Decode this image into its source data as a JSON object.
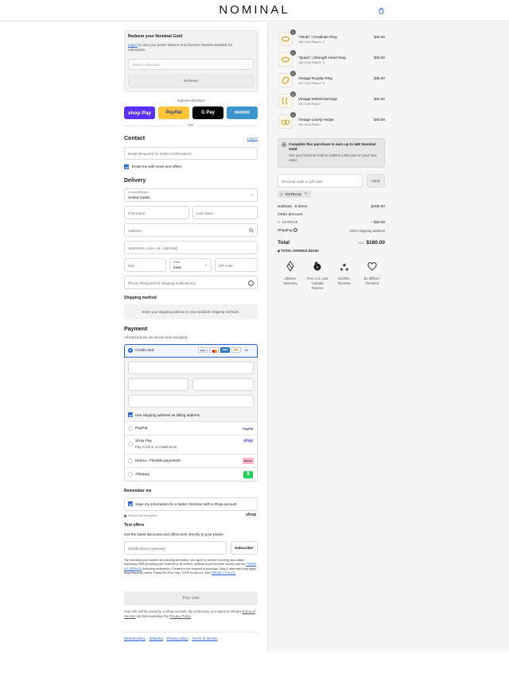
{
  "brand": "NOMINAL",
  "gold": {
    "title": "Redeem your Nominal Gold",
    "login_link": "Log in",
    "desc": "to view your points balance and discover rewards available for redemption.",
    "select_placeholder": "Select a discount",
    "redeem_label": "Redeem"
  },
  "express": {
    "label": "Express checkout",
    "shoppay": "shop Pay",
    "paypal": "PayPal",
    "gpay": "G Pay",
    "venmo": "venmo",
    "or": "OR"
  },
  "contact": {
    "title": "Contact",
    "login_link": "Log in",
    "email_placeholder": "Email (Required for Order Confirmation)",
    "news_label": "Email me with news and offers"
  },
  "delivery": {
    "title": "Delivery",
    "country_label": "Country/Region",
    "country_value": "United States",
    "first_name": "First name",
    "last_name": "Last name",
    "address": "Address",
    "apartment": "Apartment, suite, etc. (optional)",
    "city": "City",
    "state_label": "State",
    "state_value": "Iowa",
    "zip": "ZIP code",
    "phone": "Phone (Required for shipping notifications)"
  },
  "shipping_method": {
    "title": "Shipping method",
    "note": "Enter your shipping address to view available shipping methods."
  },
  "payment": {
    "title": "Payment",
    "subtitle": "All transactions are secure and encrypted.",
    "credit_card": "Credit card",
    "cards": [
      "VISA",
      "MC",
      "AMEX",
      "DISC"
    ],
    "more_cards": "+6",
    "billing_same": "Use shipping address as billing address",
    "paypal": "PayPal",
    "paypal_logo": "PayPal",
    "shoppay": "Shop Pay",
    "shoppay_sub": "Pay in full or in installments",
    "shoppay_logo": "shop",
    "klarna": "Klarna - Flexible payments",
    "klarna_logo": "Klarna.",
    "afterpay": "Afterpay",
    "afterpay_logo": "$"
  },
  "remember": {
    "title": "Remember me",
    "save_label": "Save my information for a faster checkout with a Shop account",
    "secure": "Secure and encrypted",
    "shop_logo": "shop"
  },
  "text_offers": {
    "title": "Text offers",
    "subtitle": "Get the latest discounts and offers sent directly to your phone",
    "mobile_placeholder": "Mobile phone (optional)",
    "subscribe": "Subscribe*",
    "disclaimer_1": "*By providing your number and clicking the button, you agree to receive recurring auto-dialed marketing SMS (including cart reminders). At content, artificial or prerecorded voices) and our",
    "terms_link": "TERMS OF SERVICE",
    "disclaimer_2": "(including arbitration). Consent is not required to purchase. Msg & data rates may apply. Msg frequency varies. Reply HELP for help, STOP to opt-out. View",
    "privacy_link": "PRIVACY POLICY"
  },
  "pay_now": "Pay now",
  "shop_terms": {
    "text_1": "Your info will be saved to a Shop account. By continuing, you agree to Shop's",
    "tos": "Terms of Service",
    "text_2": "and acknowledge the",
    "privacy": "Privacy Policy"
  },
  "footer_links": [
    "Refund policy",
    "Shipping",
    "Privacy policy",
    "Terms of service"
  ],
  "items": [
    {
      "qty": "1",
      "name": "\"Shukr\" | Gratitude Ring",
      "variant": "14K Gold Plated / 5",
      "price": "$45.00"
    },
    {
      "qty": "1",
      "name": "\"Quwa\" | Strength Heart Ring",
      "variant": "14K Gold Plated / 5",
      "price": "$40.00"
    },
    {
      "qty": "1",
      "name": "Vintage Royalty Ring",
      "variant": "14K Gold Plated / 5",
      "price": "$35.00"
    },
    {
      "qty": "1",
      "name": "Vintage Melted Earrings",
      "variant": "14K Gold Plated",
      "price": "$40.00"
    },
    {
      "qty": "1",
      "name": "Vintage Lovely Hoops",
      "variant": "14K Gold Plated",
      "price": "$40.00"
    }
  ],
  "gold_promo": {
    "title": "Complete this purchase to earn up to 540 Nominal Gold",
    "desc": "Use your Nominal Gold to redeem a discount on your next order."
  },
  "discount": {
    "placeholder": "Discount code or gift card",
    "apply": "Apply",
    "code": "EXTRA15"
  },
  "summary": {
    "subtotal_label": "Subtotal · 5 items",
    "subtotal": "$200.00",
    "order_discount_label": "Order discount",
    "discount_code": "EXTRA15",
    "discount_value": "− $20.00",
    "shipping_label": "Shipping",
    "shipping_value": "Enter shipping address",
    "total_label": "Total",
    "currency": "USD",
    "total": "$180.00",
    "savings_label": "TOTAL SAVINGS",
    "savings": "$20.00"
  },
  "trust_badges": [
    {
      "line1": "Lifetime",
      "line2": "Warranty",
      "line3": ""
    },
    {
      "line1": "Free U.S. and",
      "line2": "Canada",
      "line3": "Returns"
    },
    {
      "line1": "20,000+",
      "line2": "Reviews",
      "line3": ""
    },
    {
      "line1": "$1 Million+",
      "line2": "Donated",
      "line3": ""
    }
  ],
  "colors": {
    "accent": "#2563d4",
    "shoppay": "#5a31f4",
    "paypal": "#ffc439",
    "venmo": "#3d95ce"
  }
}
